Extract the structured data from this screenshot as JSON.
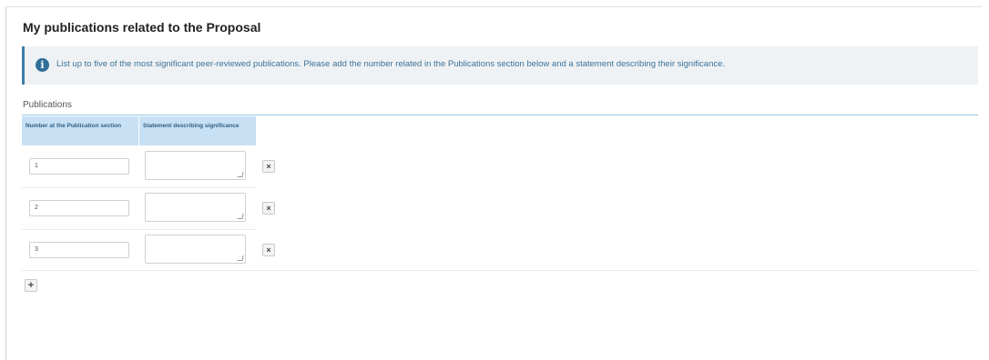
{
  "section": {
    "title": "My publications related to the Proposal",
    "info_icon": "info-circle-icon",
    "info_text": "List up to five of the most significant peer-reviewed publications. Please add the number related in the Publications section below and a statement describing their significance."
  },
  "publications": {
    "label": "Publications",
    "columns": [
      "Number at the Publication section",
      "Statement describing significance"
    ],
    "rows": [
      {
        "number": "1",
        "statement": ""
      },
      {
        "number": "2",
        "statement": ""
      },
      {
        "number": "3",
        "statement": ""
      }
    ],
    "delete_symbol": "×",
    "add_symbol": "+"
  }
}
